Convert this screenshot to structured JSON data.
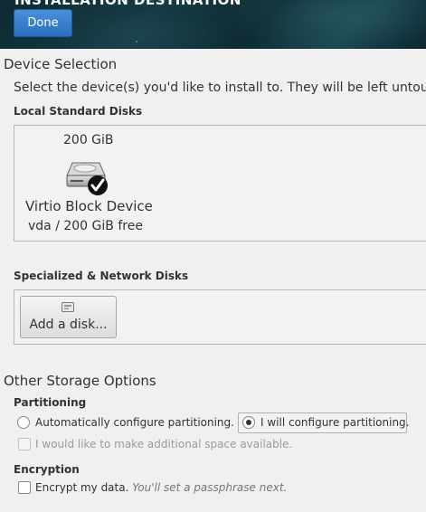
{
  "header": {
    "title": "INSTALLATION DESTINATION",
    "done_label": "Done"
  },
  "device_selection": {
    "title": "Device Selection",
    "intro": "Select the device(s) you'd like to install to.  They will be left untou",
    "local_disks_label": "Local Standard Disks",
    "disk": {
      "size": "200 GiB",
      "name": "Virtio Block Device",
      "detail": "vda  /  200 GiB free",
      "selected": true
    },
    "specialized_label": "Specialized & Network Disks",
    "add_disk_label": "Add a disk..."
  },
  "other_storage": {
    "title": "Other Storage Options",
    "partitioning_label": "Partitioning",
    "auto_partition_label": "Automatically configure partitioning.",
    "manual_partition_label": "I will configure partitioning.",
    "manual_selected": true,
    "extra_space_label": "I would like to make additional space available.",
    "extra_space_enabled": false,
    "encryption_label": "Encryption",
    "encrypt_label": "Encrypt my data.",
    "encrypt_hint": "You'll set a passphrase next."
  },
  "colors": {
    "header_bg": "#163b44",
    "accent": "#2b6fc0"
  }
}
